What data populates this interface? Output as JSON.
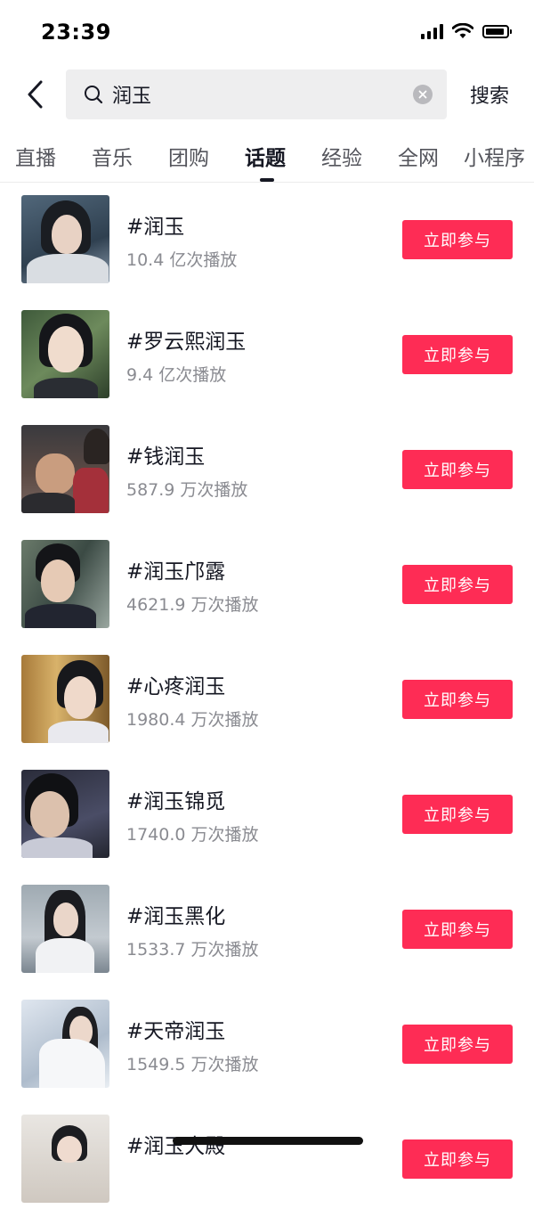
{
  "status_bar": {
    "time": "23:39"
  },
  "search": {
    "query": "润玉",
    "submit_label": "搜索"
  },
  "tabs": [
    {
      "label": "直播"
    },
    {
      "label": "音乐"
    },
    {
      "label": "团购"
    },
    {
      "label": "话题"
    },
    {
      "label": "经验"
    },
    {
      "label": "全网"
    },
    {
      "label": "小程序"
    }
  ],
  "active_tab": "话题",
  "join_label": "立即参与",
  "topics": [
    {
      "title": "#润玉",
      "views": "10.4 亿次播放"
    },
    {
      "title": "#罗云熙润玉",
      "views": "9.4 亿次播放"
    },
    {
      "title": "#钱润玉",
      "views": "587.9 万次播放"
    },
    {
      "title": "#润玉邝露",
      "views": "4621.9 万次播放"
    },
    {
      "title": "#心疼润玉",
      "views": "1980.4 万次播放"
    },
    {
      "title": "#润玉锦觅",
      "views": "1740.0 万次播放"
    },
    {
      "title": "#润玉黑化",
      "views": "1533.7 万次播放"
    },
    {
      "title": "#天帝润玉",
      "views": "1549.5 万次播放"
    },
    {
      "title": "#润玉大殿",
      "views": ""
    }
  ],
  "colors": {
    "accent": "#fe2c55",
    "text": "#161823",
    "muted": "#8a8b91"
  }
}
